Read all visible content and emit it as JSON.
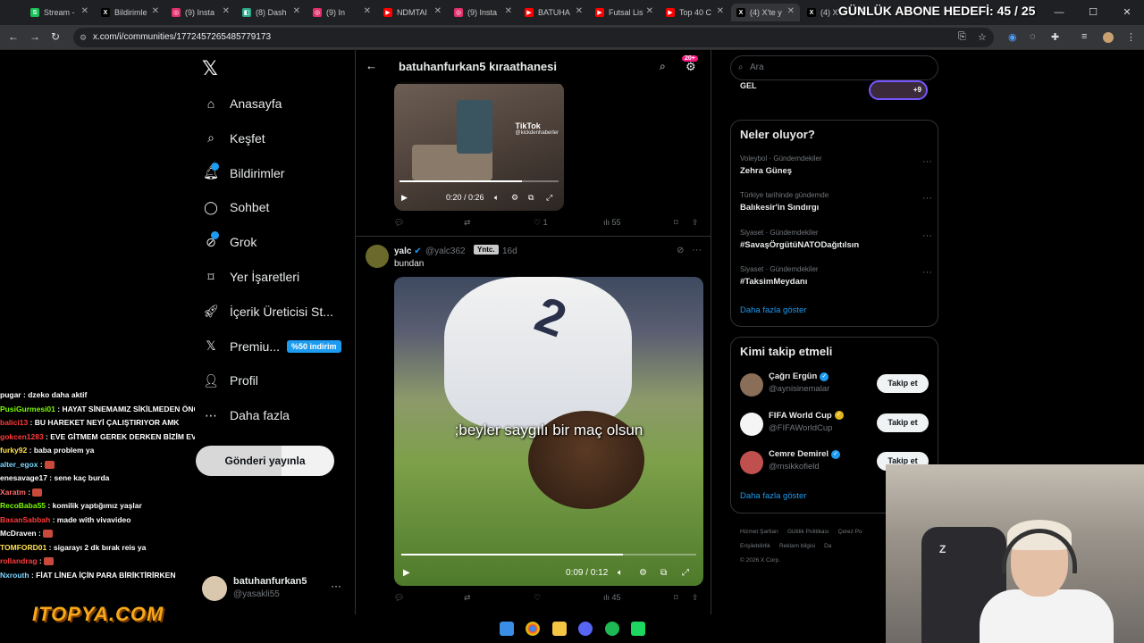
{
  "browser": {
    "tabs": [
      {
        "label": "Stream -",
        "fav": "S",
        "color": "#18c15a"
      },
      {
        "label": "Bildirimle",
        "fav": "X",
        "color": "#000000"
      },
      {
        "label": "(9) Insta",
        "fav": "◎",
        "color": "#e1306c"
      },
      {
        "label": "(8) Dash",
        "fav": "◧",
        "color": "#2aa889"
      },
      {
        "label": "(9) In",
        "fav": "◎",
        "color": "#e1306c"
      },
      {
        "label": "NDMTAI",
        "fav": "▶",
        "color": "#ff0000"
      },
      {
        "label": "(9) Insta",
        "fav": "◎",
        "color": "#e1306c"
      },
      {
        "label": "BATUHA",
        "fav": "▶",
        "color": "#ff0000"
      },
      {
        "label": "Futsal Lis",
        "fav": "▶",
        "color": "#ff0000"
      },
      {
        "label": "Top 40 C",
        "fav": "▶",
        "color": "#ff0000"
      },
      {
        "label": "(4) X'te y",
        "fav": "X",
        "color": "#000000"
      },
      {
        "label": "(4) X'",
        "fav": "X",
        "color": "#000000"
      }
    ],
    "url": "x.com/i/communities/1772457265485779173",
    "overlay_title": "GÜNLÜK ABONE HEDEFİ: 45 / 25"
  },
  "nav": {
    "items": [
      {
        "label": "Anasayfa",
        "icon": "home-icon"
      },
      {
        "label": "Keşfet",
        "icon": "search-icon"
      },
      {
        "label": "Bildirimler",
        "icon": "bell-icon"
      },
      {
        "label": "Sohbet",
        "icon": "chat-icon"
      },
      {
        "label": "Grok",
        "icon": "grok-icon"
      },
      {
        "label": "Yer İşaretleri",
        "icon": "bookmark-icon"
      },
      {
        "label": "İçerik Üreticisi St...",
        "icon": "rocket-icon"
      },
      {
        "label": "Premiu...",
        "icon": "x-logo-icon"
      },
      {
        "label": "Profil",
        "icon": "person-icon"
      },
      {
        "label": "Daha fazla",
        "icon": "more-circle-icon"
      }
    ],
    "premium_badge": "%50 indirim",
    "post_button": "Gönderi yayınla",
    "account": {
      "name": "batuhanfurkan5",
      "handle": "@yasakli55"
    }
  },
  "chat": [
    {
      "user": "pugar",
      "msg": "dzeko daha aktif",
      "color": "#ffffff"
    },
    {
      "user": "PusiGurmesi01",
      "msg": "HAYAT SİNEMAMIZ SİKİLMEDEN ÖNCE BİZ",
      "color": "#7cfc00"
    },
    {
      "user": "balici13",
      "msg": "BU HAREKET NEYİ ÇALIŞTIRIYOR AMK",
      "color": "#ff3b3b"
    },
    {
      "user": "gokcen1283",
      "msg": "EVE GİTMEM GEREK DERKEN BİZİM EV",
      "color": "#ff3b3b"
    },
    {
      "user": "furky92",
      "msg": "baba problem ya",
      "color": "#ffe14d"
    },
    {
      "user": "alter_egox",
      "msg": "",
      "color": "#7ad7ff"
    },
    {
      "user": "enesavage17",
      "msg": "sene kaç burda",
      "color": "#ffffff"
    },
    {
      "user": "Xaratm",
      "msg": "",
      "color": "#ff6b6b"
    },
    {
      "user": "RecoBaba55",
      "msg": "komilik yaptığımız yaşlar",
      "color": "#7cfc00"
    },
    {
      "user": "BasanSabbah",
      "msg": "made with vivavideo",
      "color": "#ff3b3b"
    },
    {
      "user": "McDraven",
      "msg": "",
      "color": "#ffffff"
    },
    {
      "user": "TOMFORD01",
      "msg": "sigarayı 2 dk bırak reis ya",
      "color": "#ffe14d"
    },
    {
      "user": "rollandrag",
      "msg": "",
      "color": "#ff3b3b"
    },
    {
      "user": "Nxrouth",
      "msg": "FİAT LİNEA İÇİN PARA BİRİKTİRİRKEN",
      "color": "#7ad7ff"
    }
  ],
  "sponsor": "ITOPYA.COM",
  "community": {
    "title": "batuhanfurkan5 kıraathanesi",
    "notif_badge": "20+",
    "post1": {
      "tiktok": "TikTok",
      "tiktok_handle": "@kickdenhaberler",
      "time": "0:20 / 0:26",
      "progress": 0.77,
      "likes": "1",
      "views": "55"
    },
    "post2": {
      "name": "yalc",
      "handle": "@yalc362",
      "role": "Yntc.",
      "age": "16d",
      "text": "bundan",
      "subtitle": ";beyler saygılı bir maç olsun",
      "time": "0:09 / 0:12",
      "progress": 0.75,
      "views": "45"
    }
  },
  "right": {
    "search_placeholder": "Ara",
    "top_label": "GEL",
    "space_count": "+9",
    "trends_title": "Neler oluyor?",
    "trends": [
      {
        "cat": "Voleybol · Gündemdekiler",
        "title": "Zehra Güneş"
      },
      {
        "cat": "Türkiye tarihinde gündemde",
        "title": "Balıkesir'in Sındırgı"
      },
      {
        "cat": "Siyaset · Gündemdekiler",
        "title": "#SavaşÖrgütüNATODağıtılsın"
      },
      {
        "cat": "Siyaset · Gündemdekiler",
        "title": "#TaksimMeydanı"
      }
    ],
    "show_more": "Daha fazla göster",
    "who_title": "Kimi takip etmeli",
    "who": [
      {
        "name": "Çağrı Ergün",
        "handle": "@aynisinemalar",
        "verify_color": "#1d9bf0",
        "avatar_color": "#8a6e58"
      },
      {
        "name": "FIFA World Cup",
        "handle": "@FIFAWorldCup",
        "verify_color": "#e2b719",
        "avatar_color": "#f5f5f5"
      },
      {
        "name": "Cemre Demirel",
        "handle": "@msikkofield",
        "verify_color": "#1d9bf0",
        "avatar_color": "#c0504d"
      }
    ],
    "follow_label": "Takip et",
    "who_show_more": "Daha fazla göster",
    "footer": [
      "Hizmet Şartları",
      "Gizlilik Politikası",
      "Çerez Po",
      "Erişilebilirlik",
      "Reklam bilgisi",
      "Da",
      "© 2026 X Corp."
    ]
  }
}
